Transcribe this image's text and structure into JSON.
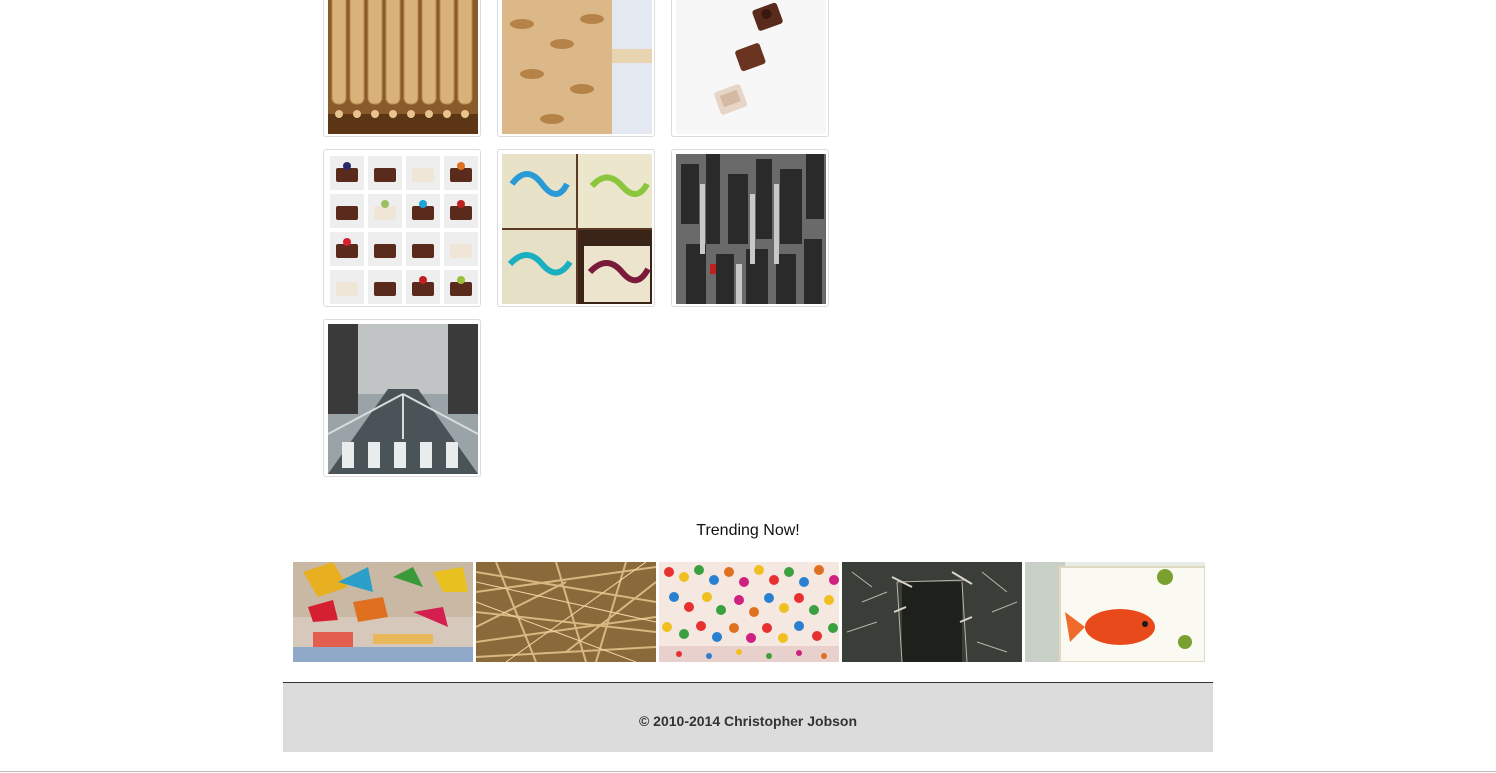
{
  "gallery": {
    "thumbnails": [
      {
        "name": "rolling-pins-photo"
      },
      {
        "name": "mustache-rolling-pin-photo"
      },
      {
        "name": "chocolate-blocks-photo"
      },
      {
        "name": "chocolate-grid-photo"
      },
      {
        "name": "calligraphy-photo"
      },
      {
        "name": "city-aerial-painting"
      },
      {
        "name": "city-street-painting"
      }
    ]
  },
  "trending": {
    "title": "Trending Now!",
    "items": [
      {
        "name": "colorful-hanging-installation"
      },
      {
        "name": "wooden-sticks-installation"
      },
      {
        "name": "dot-room-installation"
      },
      {
        "name": "branch-doorway-installation"
      },
      {
        "name": "resin-goldfish-artwork"
      }
    ]
  },
  "footer": {
    "copyright": "© 2010-2014 Christopher Jobson"
  }
}
